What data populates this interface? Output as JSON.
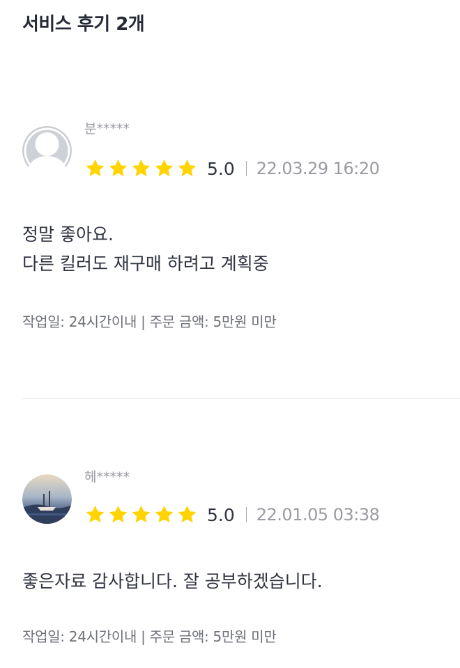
{
  "header": {
    "title": "서비스 후기 2개"
  },
  "reviews": [
    {
      "username": "분*****",
      "avatar": "default-profile-icon",
      "star_color": "#FFD400",
      "rating": 5,
      "score": "5.0",
      "date": "22.03.29 16:20",
      "content": "정말 좋아요.\n다른 킬러도 재구매 하려고 계획중",
      "meta": "작업일: 24시간이내 | 주문 금액: 5만원 미만"
    },
    {
      "username": "헤*****",
      "avatar": "landscape-photo-avatar",
      "star_color": "#FFD400",
      "rating": 5,
      "score": "5.0",
      "date": "22.01.05 03:38",
      "content": "좋은자료 감사합니다. 잘 공부하겠습니다.",
      "meta": "작업일: 24시간이내 | 주문 금액: 5만원 미만"
    }
  ]
}
